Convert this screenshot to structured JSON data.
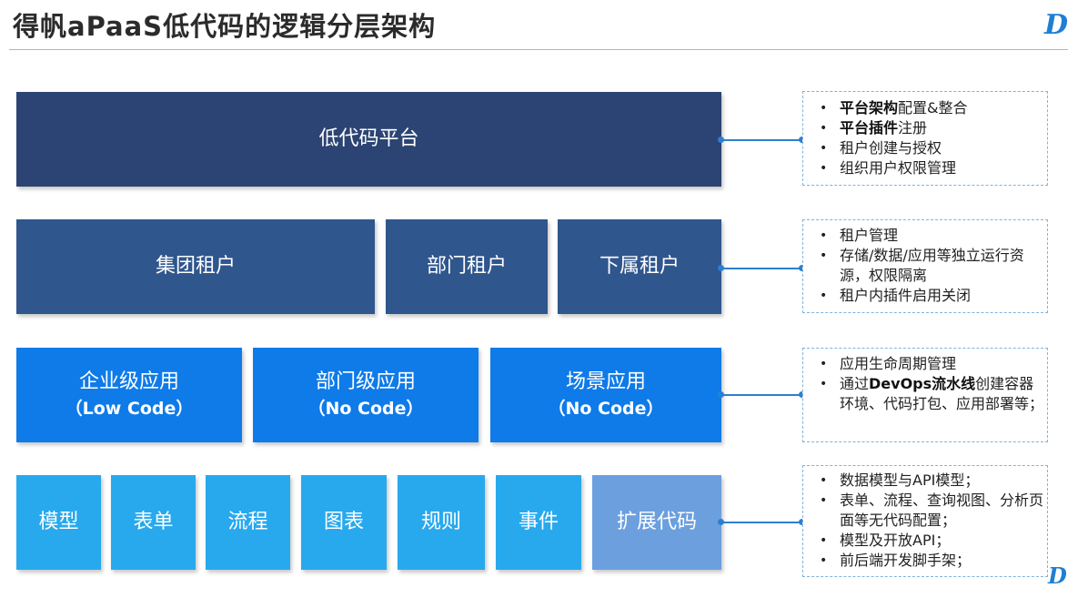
{
  "header": {
    "title": "得帆aPaaS低代码的逻辑分层架构",
    "logo_text": "D"
  },
  "colors": {
    "platform": "#2c4473",
    "tenant": "#2f568d",
    "app": "#0f7be9",
    "component": "#28a9ee",
    "extension": "#6c9fde",
    "connector": "#2c7fd0"
  },
  "layers": {
    "platform": {
      "label": "低代码平台"
    },
    "tenants": [
      {
        "label": "集团租户"
      },
      {
        "label": "部门租户"
      },
      {
        "label": "下属租户"
      }
    ],
    "apps": [
      {
        "label": "企业级应用",
        "sub": "（Low Code）"
      },
      {
        "label": "部门级应用",
        "sub": "（No Code）"
      },
      {
        "label": "场景应用",
        "sub": "（No Code）"
      }
    ],
    "components": [
      {
        "label": "模型"
      },
      {
        "label": "表单"
      },
      {
        "label": "流程"
      },
      {
        "label": "图表"
      },
      {
        "label": "规则"
      },
      {
        "label": "事件"
      },
      {
        "label": "扩展代码"
      }
    ]
  },
  "notes": {
    "platform": [
      {
        "bold": "平台架构",
        "text": "配置&整合"
      },
      {
        "bold": "平台插件",
        "text": "注册"
      },
      {
        "bold": "",
        "text": "租户创建与授权"
      },
      {
        "bold": "",
        "text": "组织用户权限管理"
      }
    ],
    "tenant": [
      {
        "bold": "",
        "text": "租户管理"
      },
      {
        "bold": "",
        "text": "存储/数据/应用等独立运行资源，权限隔离"
      },
      {
        "bold": "",
        "text": "租户内插件启用关闭"
      }
    ],
    "app": [
      {
        "bold": "",
        "text": "应用生命周期管理"
      },
      {
        "pre": "通过",
        "bold": "DevOps流水线",
        "text": "创建容器环境、代码打包、应用部署等；"
      }
    ],
    "component": [
      {
        "bold": "",
        "text": "数据模型与API模型；"
      },
      {
        "bold": "",
        "text": "表单、流程、查询视图、分析页面等无代码配置；"
      },
      {
        "bold": "",
        "text": "模型及开放API；"
      },
      {
        "bold": "",
        "text": "前后端开发脚手架；"
      }
    ]
  }
}
